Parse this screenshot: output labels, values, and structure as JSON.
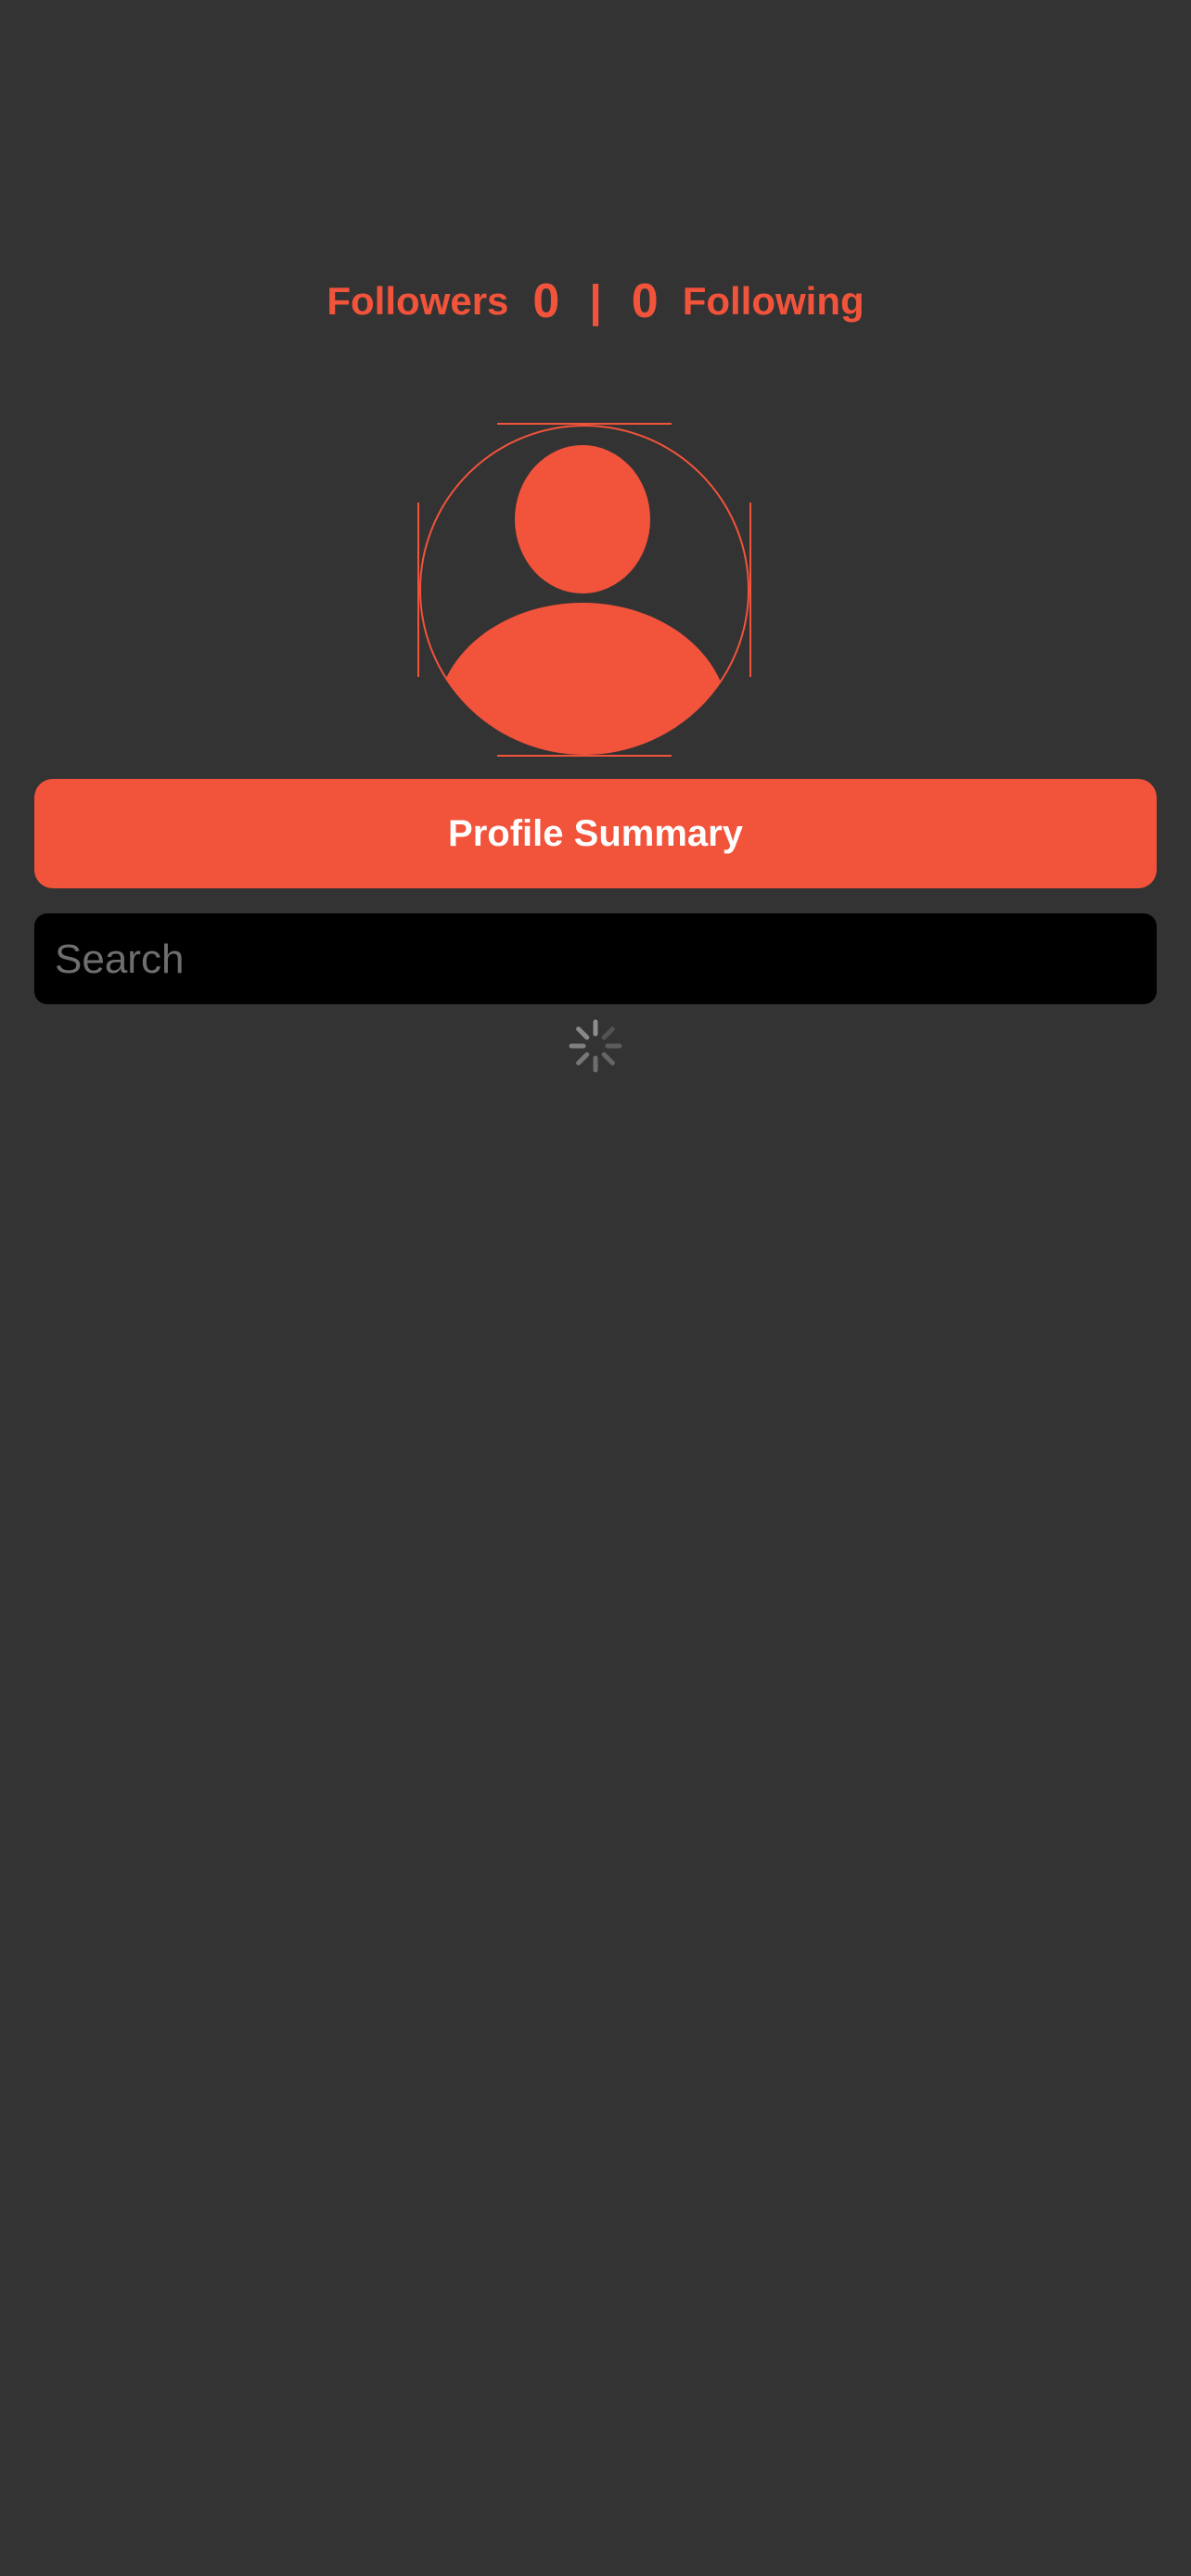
{
  "theme": {
    "background": "#333333",
    "accent": "#F2533B",
    "search_background": "#000000",
    "placeholder_color": "#6E6E6E",
    "spinner_color": "#8E8E8E"
  },
  "stats": {
    "followers_label": "Followers",
    "followers_count": "0",
    "divider": "|",
    "following_count": "0",
    "following_label": "Following"
  },
  "avatar": {
    "icon": "person-icon"
  },
  "profile_summary": {
    "label": "Profile Summary"
  },
  "search": {
    "placeholder": "Search",
    "value": ""
  },
  "loading": {
    "icon": "spinner-icon"
  }
}
